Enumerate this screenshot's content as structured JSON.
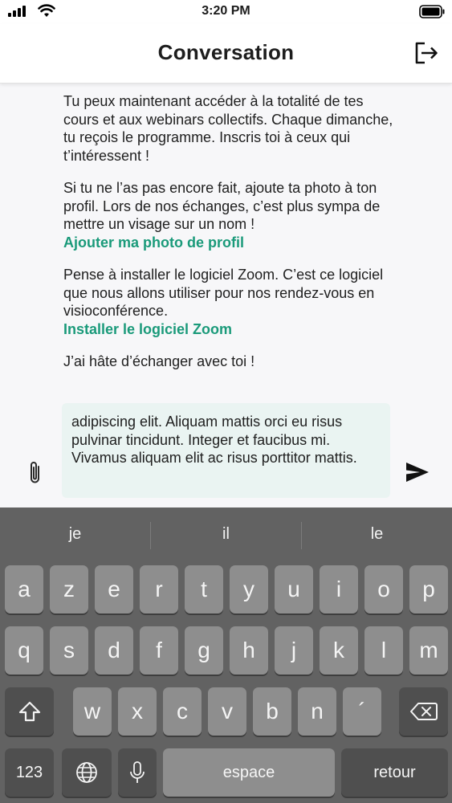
{
  "status": {
    "time": "3:20 PM"
  },
  "header": {
    "title": "Conversation"
  },
  "message": {
    "paragraph1": "Tu peux maintenant accéder à la totalité de tes cours et aux webinars collectifs. Chaque dimanche, tu reçois le programme. Inscris toi à ceux qui t’intéressent !",
    "paragraph2": "Si tu ne l’as pas encore fait, ajoute ta photo à ton profil. Lors de nos échanges, c’est plus sympa de mettre un visage sur un nom !",
    "link_photo": "Ajouter ma photo de profil",
    "paragraph3": "Pense à installer le logiciel Zoom. C’est ce logiciel que nous allons utiliser pour nos rendez-vous en visioconférence.",
    "link_zoom": "Installer le logiciel Zoom",
    "paragraph4": "J’ai hâte d’échanger avec toi !"
  },
  "composer": {
    "value": "adipiscing elit. Aliquam mattis orci eu risus pulvinar tincidunt. Integer et faucibus mi. Vivamus aliquam elit ac risus porttitor mattis."
  },
  "colors": {
    "accent": "#1a9a7a",
    "input_bg": "#eaf4f2",
    "keyboard_bg": "#626262"
  },
  "keyboard": {
    "suggestions": [
      "je",
      "il",
      "le"
    ],
    "row1": [
      "a",
      "z",
      "e",
      "r",
      "t",
      "y",
      "u",
      "i",
      "o",
      "p"
    ],
    "row2": [
      "q",
      "s",
      "d",
      "f",
      "g",
      "h",
      "j",
      "k",
      "l",
      "m"
    ],
    "row3": [
      "w",
      "x",
      "c",
      "v",
      "b",
      "n",
      "´"
    ],
    "numbers_label": "123",
    "space_label": "espace",
    "return_label": "retour",
    "icons": [
      "shift-icon",
      "backspace-icon",
      "globe-icon",
      "microphone-icon"
    ]
  }
}
